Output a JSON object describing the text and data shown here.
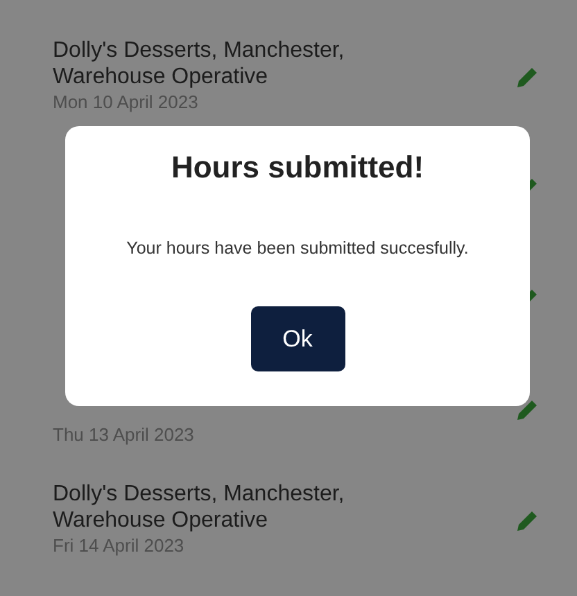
{
  "entries": [
    {
      "kind": "full",
      "title_lines": [
        "Dolly's Desserts, Manchester,",
        "Warehouse Operative"
      ],
      "date": "Mon 10 April 2023"
    },
    {
      "kind": "covered"
    },
    {
      "kind": "covered"
    },
    {
      "kind": "date_only",
      "date": "Thu 13 April 2023"
    },
    {
      "kind": "full",
      "title_lines": [
        "Dolly's Desserts, Manchester,",
        "Warehouse Operative"
      ],
      "date": "Fri 14 April 2023"
    }
  ],
  "dialog": {
    "title": "Hours submitted!",
    "message": "Your hours have been submitted succesfully.",
    "button": "Ok"
  }
}
